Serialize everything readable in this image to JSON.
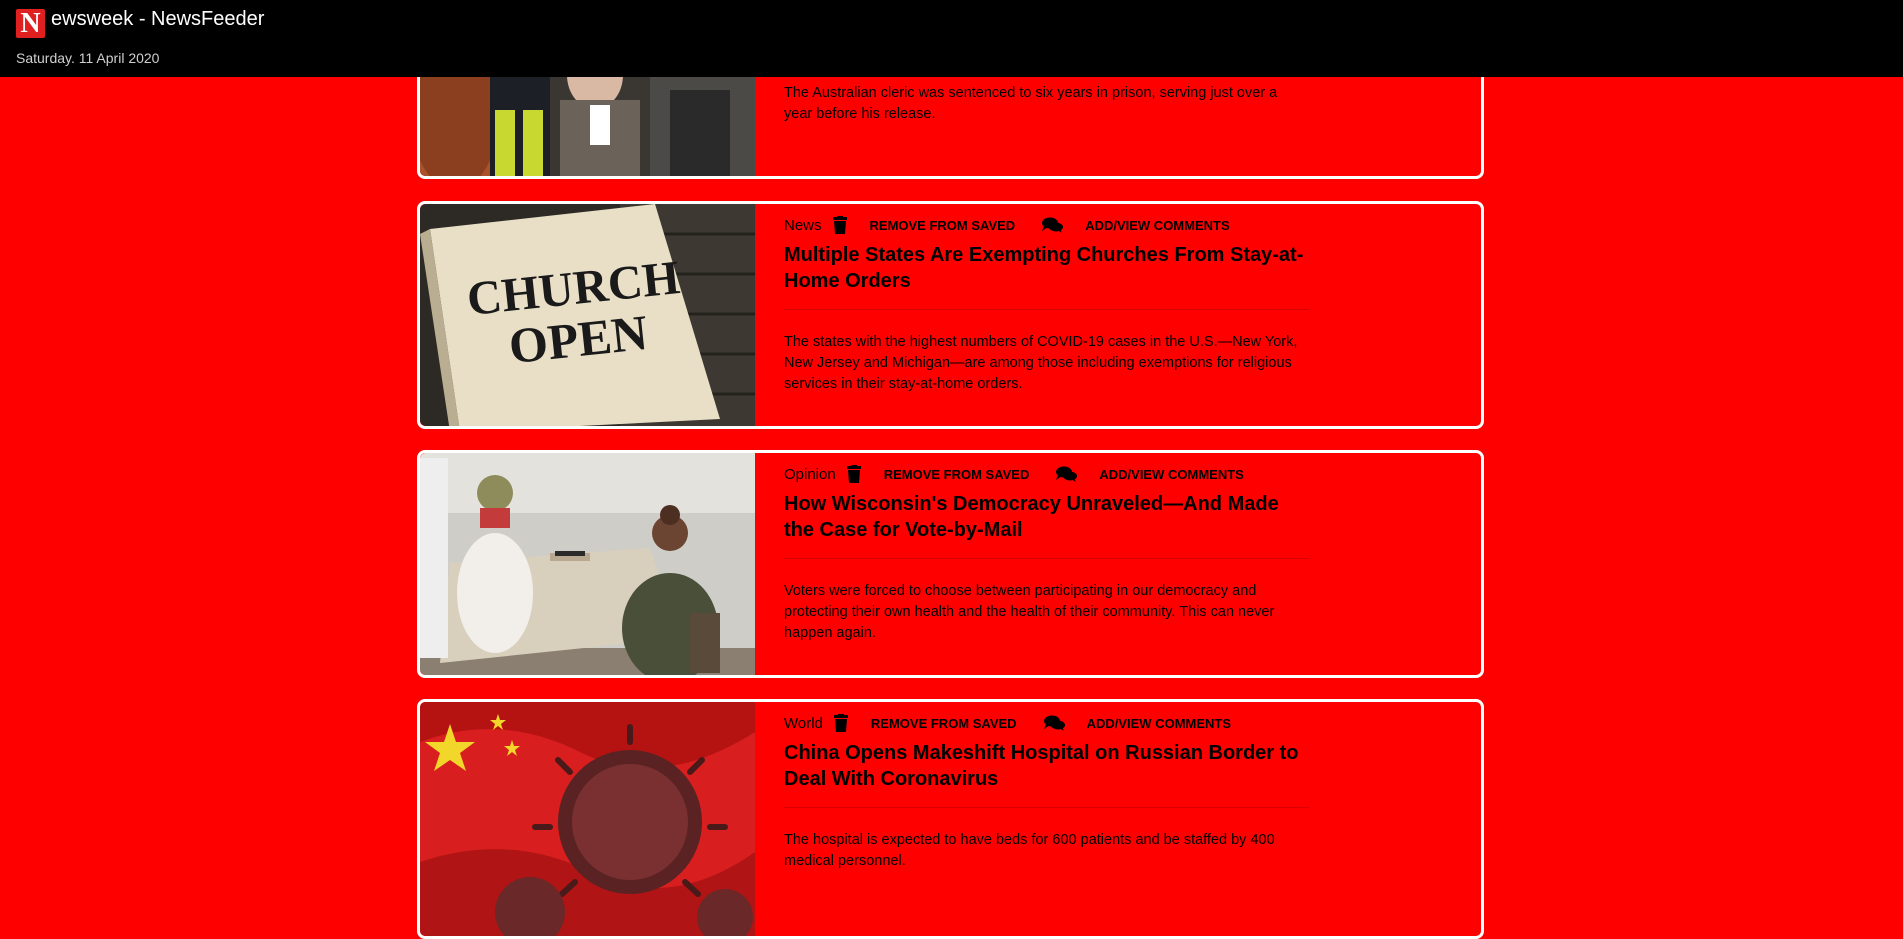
{
  "app": {
    "logo_letter": "N",
    "title": "ewsweek - NewsFeeder",
    "date": "Saturday. 11 April 2020"
  },
  "articles": [
    {
      "category": "",
      "remove_label": "",
      "comments_label": "",
      "headline": "",
      "summary": "The Australian cleric was sentenced to six years in prison, serving just over a year before his release.",
      "image_icon": "cleric-photo"
    },
    {
      "category": "News",
      "remove_label": "REMOVE FROM SAVED",
      "comments_label": "ADD/VIEW COMMENTS",
      "headline": "Multiple States Are Exempting Churches From Stay-at-Home Orders",
      "summary": "The states with the highest numbers of COVID-19 cases in the U.S.—New York, New Jersey and Michigan—are among those including exemptions for religious services in their stay-at-home orders.",
      "image_text_line1": "CHURCH",
      "image_text_line2": "OPEN"
    },
    {
      "category": "Opinion",
      "remove_label": "REMOVE FROM SAVED",
      "comments_label": "ADD/VIEW COMMENTS",
      "headline": "How Wisconsin's Democracy Unraveled—And Made the Case for Vote-by-Mail",
      "summary": "Voters were forced to choose between participating in our democracy and protecting their own health and the health of their community. This can never happen again.",
      "image_icon": "polling-station-photo"
    },
    {
      "category": "World",
      "remove_label": "REMOVE FROM SAVED",
      "comments_label": "ADD/VIEW COMMENTS",
      "headline": "China Opens Makeshift Hospital on Russian Border to Deal With Coronavirus",
      "summary": "The hospital is expected to have beds for 600 patients and be staffed by 400 medical personnel.",
      "image_icon": "coronavirus-flag-photo"
    }
  ],
  "colors": {
    "page_bg": "#ff0000",
    "topbar_bg": "#000000",
    "card_border": "#ffffff"
  }
}
